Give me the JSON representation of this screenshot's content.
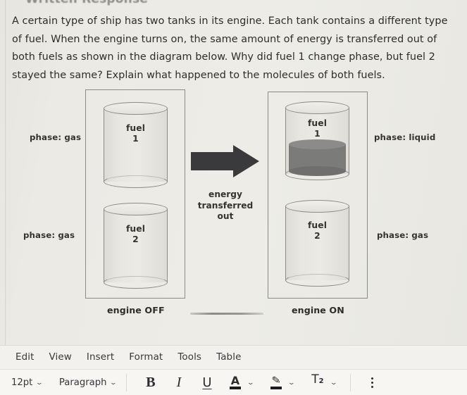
{
  "header": {
    "title": "Written Response"
  },
  "prompt": {
    "text": "A certain type of ship has two tanks in its engine. Each tank contains a different type of fuel. When the engine turns on, the same amount of energy is transferred out of both fuels as shown in the diagram below. Why did fuel 1 change phase, but fuel 2 stayed the same? Explain what happened to the molecules of both fuels."
  },
  "diagram": {
    "engine_off": {
      "caption": "engine OFF",
      "tanks": [
        {
          "label_line1": "fuel",
          "label_line2": "1",
          "phase_label": "phase: gas",
          "has_liquid": false
        },
        {
          "label_line1": "fuel",
          "label_line2": "2",
          "phase_label": "phase: gas",
          "has_liquid": false
        }
      ]
    },
    "energy_arrow": {
      "label_line1": "energy",
      "label_line2": "transferred",
      "label_line3": "out",
      "color": "#3a3a3d",
      "direction": "right"
    },
    "engine_on": {
      "caption": "engine ON",
      "tanks": [
        {
          "label_line1": "fuel",
          "label_line2": "1",
          "phase_label": "phase: liquid",
          "has_liquid": true
        },
        {
          "label_line1": "fuel",
          "label_line2": "2",
          "phase_label": "phase: gas",
          "has_liquid": false
        }
      ]
    }
  },
  "menubar": {
    "items": [
      {
        "label": "Edit"
      },
      {
        "label": "View"
      },
      {
        "label": "Insert"
      },
      {
        "label": "Format"
      },
      {
        "label": "Tools"
      },
      {
        "label": "Table"
      }
    ]
  },
  "formatbar": {
    "font_size": {
      "value": "12pt",
      "chevron": "⌄"
    },
    "block_format": {
      "value": "Paragraph",
      "chevron": "⌄"
    },
    "bold": "B",
    "italic": "I",
    "underline": "U",
    "text_color": {
      "glyph": "A",
      "swatch": "#1d1b1e",
      "chevron": "⌄"
    },
    "highlight_color": {
      "glyph": "✎",
      "swatch": "#1d1b1e",
      "chevron": "⌄"
    },
    "superscript": {
      "glyph": "T",
      "sup": "2",
      "chevron": "⌄"
    },
    "more_label": "⋮"
  },
  "colors": {
    "page_background": "#eceae4",
    "text": "#2f2d2b",
    "outline": "#8d8a85",
    "liquid": "#7b7b79",
    "toolbar_background": "#f7f6f3"
  }
}
